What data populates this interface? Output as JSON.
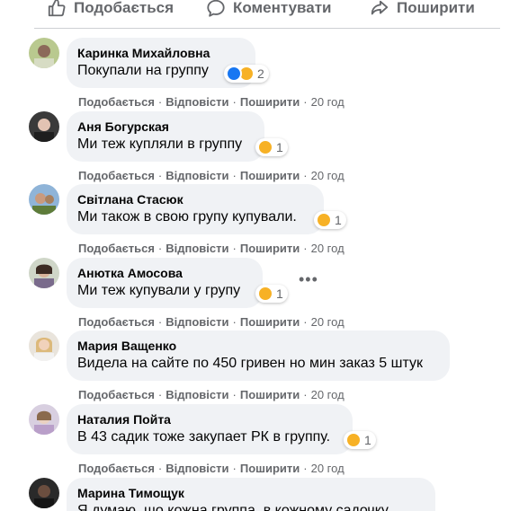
{
  "actions": {
    "like_label": "Подобається",
    "comment_label": "Коментувати",
    "share_label": "Поширити"
  },
  "comment_links": {
    "like": "Подобається",
    "reply": "Відповісти",
    "share": "Поширити",
    "separator": "·"
  },
  "comments": [
    {
      "author": "Каринка Михайловна",
      "text": "Покупали на группу",
      "reactions": [
        "like",
        "sad"
      ],
      "reaction_count": "2",
      "time": "20 год"
    },
    {
      "author": "Аня Богурская",
      "text": "Ми теж купляли в группу",
      "reactions": [
        "sad"
      ],
      "reaction_count": "1",
      "time": "20 год"
    },
    {
      "author": "Світлана Стасюк",
      "text": "Ми також в свою групу купували.",
      "reactions": [
        "sad"
      ],
      "reaction_count": "1",
      "time": "20 год"
    },
    {
      "author": "Анютка Амосова",
      "text": "Ми теж купували у групу",
      "reactions": [
        "sad"
      ],
      "reaction_count": "1",
      "time": "20 год"
    },
    {
      "author": "Мария Ващенко",
      "text": "Видела на сайте по 450 гривен но мин заказ 5 штук",
      "reactions": [],
      "reaction_count": "",
      "time": "20 год"
    },
    {
      "author": "Наталия Пойта",
      "text": "В 43 садик тоже закупает РК в группу.",
      "reactions": [
        "sad"
      ],
      "reaction_count": "1",
      "time": "20 год"
    },
    {
      "author": "Марина Тимощук",
      "text": "Я думаю, що кожна группа, в кожному садочку",
      "reactions": [],
      "reaction_count": "",
      "time": ""
    }
  ],
  "colors": {
    "bubble_bg": "#f0f2f5",
    "secondary_text": "#65676b",
    "like_blue": "#1877f2",
    "sad_yellow": "#f7b125"
  },
  "icons": {
    "like": "thumbs-up-icon",
    "comment": "speech-bubble-icon",
    "share": "share-arrow-icon",
    "more": "more-options-icon"
  }
}
